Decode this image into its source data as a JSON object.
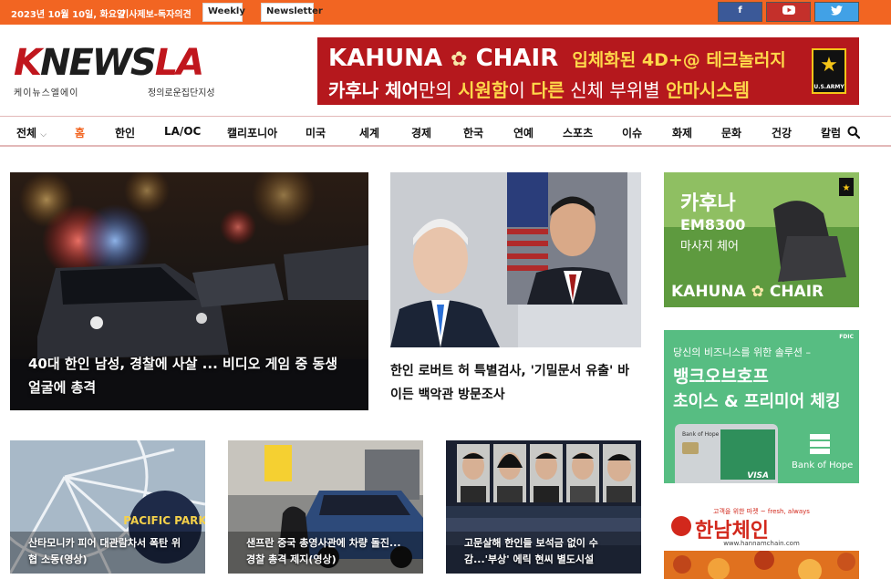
{
  "topbar": {
    "date": "2023년 10월 10일, 화요일",
    "report": "기사제보-독자의견",
    "weekly": "Weekly",
    "newsletter": "Newsletter",
    "social": {
      "facebook": "f",
      "youtube": "▶",
      "twitter": "🐦"
    }
  },
  "header": {
    "logo": {
      "k": "K",
      "news": "NEWS",
      "la": "LA",
      "sub_left": "케이뉴스엘에이",
      "sub_right": "정의로운집단지성"
    },
    "banner": {
      "brand": "KAHUNA",
      "brand2": "CHAIR",
      "tagline1": "입체화된 4D+@ 테크놀러지",
      "tagline2_a": "카후나 체어",
      "tagline2_b": "만의 ",
      "tagline2_c": "시원함",
      "tagline2_d": "이 ",
      "tagline2_e": "다른",
      "tagline2_f": " 신체 부위별 ",
      "tagline2_g": "안마시스템",
      "army": "U.S.ARMY"
    }
  },
  "nav": {
    "items": [
      "전체",
      "홈",
      "한인",
      "LA/OC",
      "캘리포니아",
      "미국",
      "세계",
      "경제",
      "한국",
      "연예",
      "스포츠",
      "이슈",
      "화제",
      "문화",
      "건강",
      "칼럼"
    ]
  },
  "articles": {
    "main": {
      "title_line1": "40대 한인 남성, 경찰에 사살 ... 비디오 게임 중 동생",
      "title_line2": "얼굴에 총격"
    },
    "second": {
      "title_line1": "한인 로버트 허 특별검사, '기밀문서 유출' 바",
      "title_line2": "이든 백악관 방문조사"
    },
    "small1": {
      "title_line1": "산타모니카 피어 대관람차서 폭탄 위",
      "title_line2": "협 소동(영상)",
      "sign": "PACIFIC PARK"
    },
    "small2": {
      "title_line1": "샌프란 중국 총영사관에 차량 돌진...",
      "title_line2": "경찰 총격 제지(영상)"
    },
    "small3": {
      "title_line1": "고문살해 한인들 보석금 없이 수",
      "title_line2": "감...'부상' 에릭 현씨 별도시설"
    }
  },
  "ads": {
    "kahuna": {
      "l1": "카후나",
      "l2": "EM8300",
      "l3": "마사지 체어",
      "brand": "KAHUNA",
      "brand2": "CHAIR"
    },
    "boh": {
      "l1": "당신의 비즈니스를 위한 솔루션 –",
      "l2": "뱅크오브호프",
      "l3": "초이스 & 프리미어 체킹",
      "brand": "Bank of Hope",
      "card_brand": "Bank of Hope",
      "visa": "VISA",
      "corner": "FDIC"
    },
    "hannam": {
      "top": "고객을 위한 마켓 ~ fresh, always",
      "name": "한남체인",
      "url": "www.hannamchain.com"
    }
  },
  "colors": {
    "accent": "#f26522",
    "brand_red": "#c0161d"
  }
}
